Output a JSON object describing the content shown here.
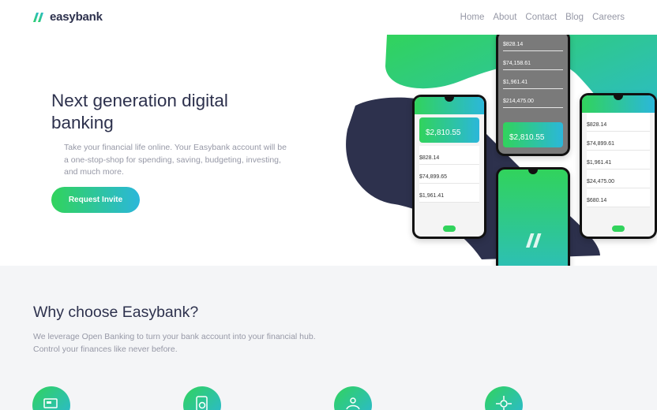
{
  "brand": {
    "name": "easybank",
    "accent_green": "#31d35c",
    "accent_cyan": "#2bb7da",
    "dark_blue": "#2d314d"
  },
  "nav": {
    "items": [
      "Home",
      "About",
      "Contact",
      "Blog",
      "Careers"
    ]
  },
  "hero": {
    "title": "Next generation digital banking",
    "text": "Take your financial life online. Your Easybank account will be a one-stop-shop for spending, saving, budgeting, investing, and much more.",
    "cta": "Request Invite"
  },
  "mockups": {
    "left": {
      "balance": "$2,810.55",
      "rows": [
        "$828.14",
        "$74,899.65",
        "$1,961.41"
      ]
    },
    "center_top": {
      "rows": [
        "$828.14",
        "$74,158.61",
        "$1,961.41",
        "$214,475.00"
      ],
      "balance": "$2,810.55"
    },
    "right": {
      "rows": [
        "$828.14",
        "$74,899.61",
        "$1,961.41",
        "$24,475.00",
        "$680.14"
      ]
    }
  },
  "why": {
    "title": "Why choose Easybank?",
    "text": "We leverage Open Banking to turn your bank account into your financial hub. Control your finances like never before.",
    "features": [
      "online-banking-icon",
      "budgeting-icon",
      "onboarding-icon",
      "api-icon"
    ]
  }
}
